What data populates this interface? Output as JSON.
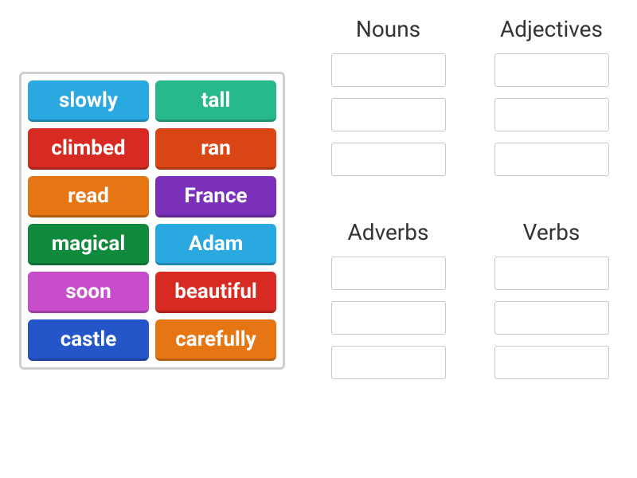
{
  "word_bank": {
    "tiles": [
      {
        "label": "slowly",
        "color": "#2aa8e0"
      },
      {
        "label": "tall",
        "color": "#27b98b"
      },
      {
        "label": "climbed",
        "color": "#d62a22"
      },
      {
        "label": "ran",
        "color": "#d94515"
      },
      {
        "label": "read",
        "color": "#e67514"
      },
      {
        "label": "France",
        "color": "#7a30b8"
      },
      {
        "label": "magical",
        "color": "#0f8a3d"
      },
      {
        "label": "Adam",
        "color": "#2aa8e0"
      },
      {
        "label": "soon",
        "color": "#c74dcb"
      },
      {
        "label": "beautiful",
        "color": "#d62a22"
      },
      {
        "label": "castle",
        "color": "#2456c9"
      },
      {
        "label": "carefully",
        "color": "#e67514"
      }
    ]
  },
  "categories": [
    {
      "title": "Nouns",
      "slots": 3
    },
    {
      "title": "Adjectives",
      "slots": 3
    },
    {
      "title": "Adverbs",
      "slots": 3
    },
    {
      "title": "Verbs",
      "slots": 3
    }
  ]
}
